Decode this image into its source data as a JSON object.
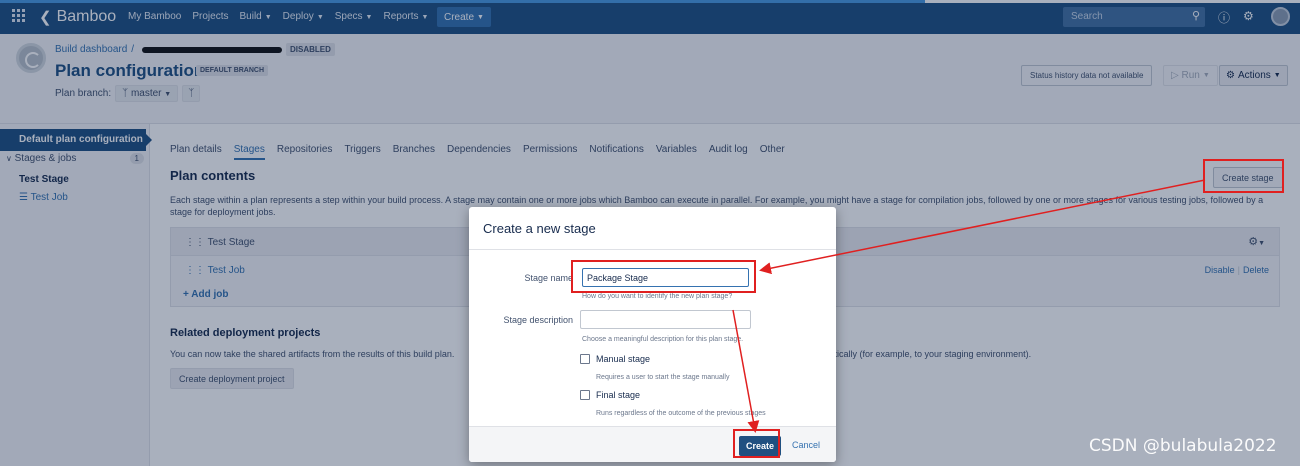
{
  "topbar": {
    "logo_text": "Bamboo",
    "nav": [
      {
        "label": "My Bamboo",
        "has_dropdown": false
      },
      {
        "label": "Projects",
        "has_dropdown": false
      },
      {
        "label": "Build",
        "has_dropdown": true
      },
      {
        "label": "Deploy",
        "has_dropdown": true
      },
      {
        "label": "Specs",
        "has_dropdown": true
      },
      {
        "label": "Reports",
        "has_dropdown": true
      }
    ],
    "create_label": "Create",
    "search_placeholder": "Search",
    "colors": {
      "bar": "#205081",
      "create_button": "#3572b0"
    }
  },
  "header": {
    "breadcrumb_root": "Build dashboard",
    "breadcrumb_sep": "/",
    "status_badge": "DISABLED",
    "title": "Plan configuration",
    "branch_badge": "DEFAULT BRANCH",
    "plan_branch_label": "Plan branch:",
    "plan_branch_value": "master",
    "status_history": "Status history data not available",
    "run_label": "Run",
    "actions_label": "Actions"
  },
  "sidebar": {
    "active_item": "Default plan configuration",
    "stages_label": "Stages & jobs",
    "stages_count": "1",
    "stage": "Test Stage",
    "job": "Test Job"
  },
  "main": {
    "tabs": [
      {
        "label": "Plan details",
        "active": false
      },
      {
        "label": "Stages",
        "active": true
      },
      {
        "label": "Repositories",
        "active": false
      },
      {
        "label": "Triggers",
        "active": false
      },
      {
        "label": "Branches",
        "active": false
      },
      {
        "label": "Dependencies",
        "active": false
      },
      {
        "label": "Permissions",
        "active": false
      },
      {
        "label": "Notifications",
        "active": false
      },
      {
        "label": "Variables",
        "active": false
      },
      {
        "label": "Audit log",
        "active": false
      },
      {
        "label": "Other",
        "active": false
      }
    ],
    "heading": "Plan contents",
    "create_stage_label": "Create stage",
    "description": "Each stage within a plan represents a step within your build process. A stage may contain one or more jobs which Bamboo can execute in parallel. For example, you might have a stage for compilation jobs, followed by one or more stages for various testing jobs, followed by a stage for deployment jobs.",
    "stage_name": "Test Stage",
    "job_name": "Test Job",
    "job_disable": "Disable",
    "job_delete": "Delete",
    "add_job": "+ Add job",
    "related_heading": "Related deployment projects",
    "related_text": "You can now take the shared artifacts from the results of this build plan.",
    "related_text_tail": "matically (for example, to your staging environment).",
    "deploy_button": "Create deployment project"
  },
  "dialog": {
    "title": "Create a new stage",
    "stage_name_label": "Stage name",
    "stage_name_value": "Package Stage",
    "stage_name_hint": "How do you want to identify the new plan stage?",
    "stage_desc_label": "Stage description",
    "stage_desc_value": "",
    "stage_desc_hint": "Choose a meaningful description for this plan stage.",
    "manual_label": "Manual stage",
    "manual_checked": false,
    "manual_hint": "Requires a user to start the stage manually",
    "final_label": "Final stage",
    "final_checked": false,
    "final_hint": "Runs regardless of the outcome of the previous stages",
    "create_label": "Create",
    "cancel_label": "Cancel"
  },
  "annotation_color": "#e02020",
  "watermark": "CSDN @bulabula2022"
}
